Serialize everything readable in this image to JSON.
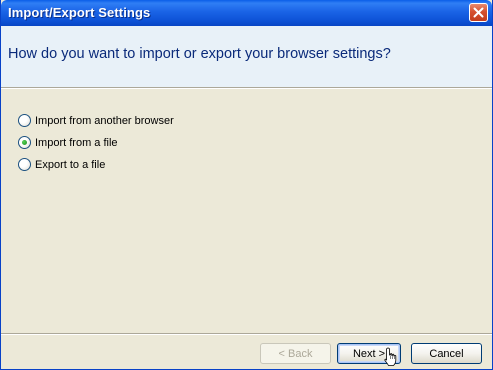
{
  "window": {
    "title": "Import/Export Settings",
    "accent": "#0a5ee8"
  },
  "header": {
    "question": "How do you want to import or export your browser settings?"
  },
  "options": [
    {
      "label": "Import from another browser",
      "checked": false
    },
    {
      "label": "Import from a file",
      "checked": true
    },
    {
      "label": "Export to a file",
      "checked": false
    }
  ],
  "footer": {
    "back_label": "< Back",
    "next_label": "Next >",
    "cancel_label": "Cancel"
  },
  "icons": {
    "close": "close-icon",
    "cursor": "hand-pointer-icon"
  }
}
